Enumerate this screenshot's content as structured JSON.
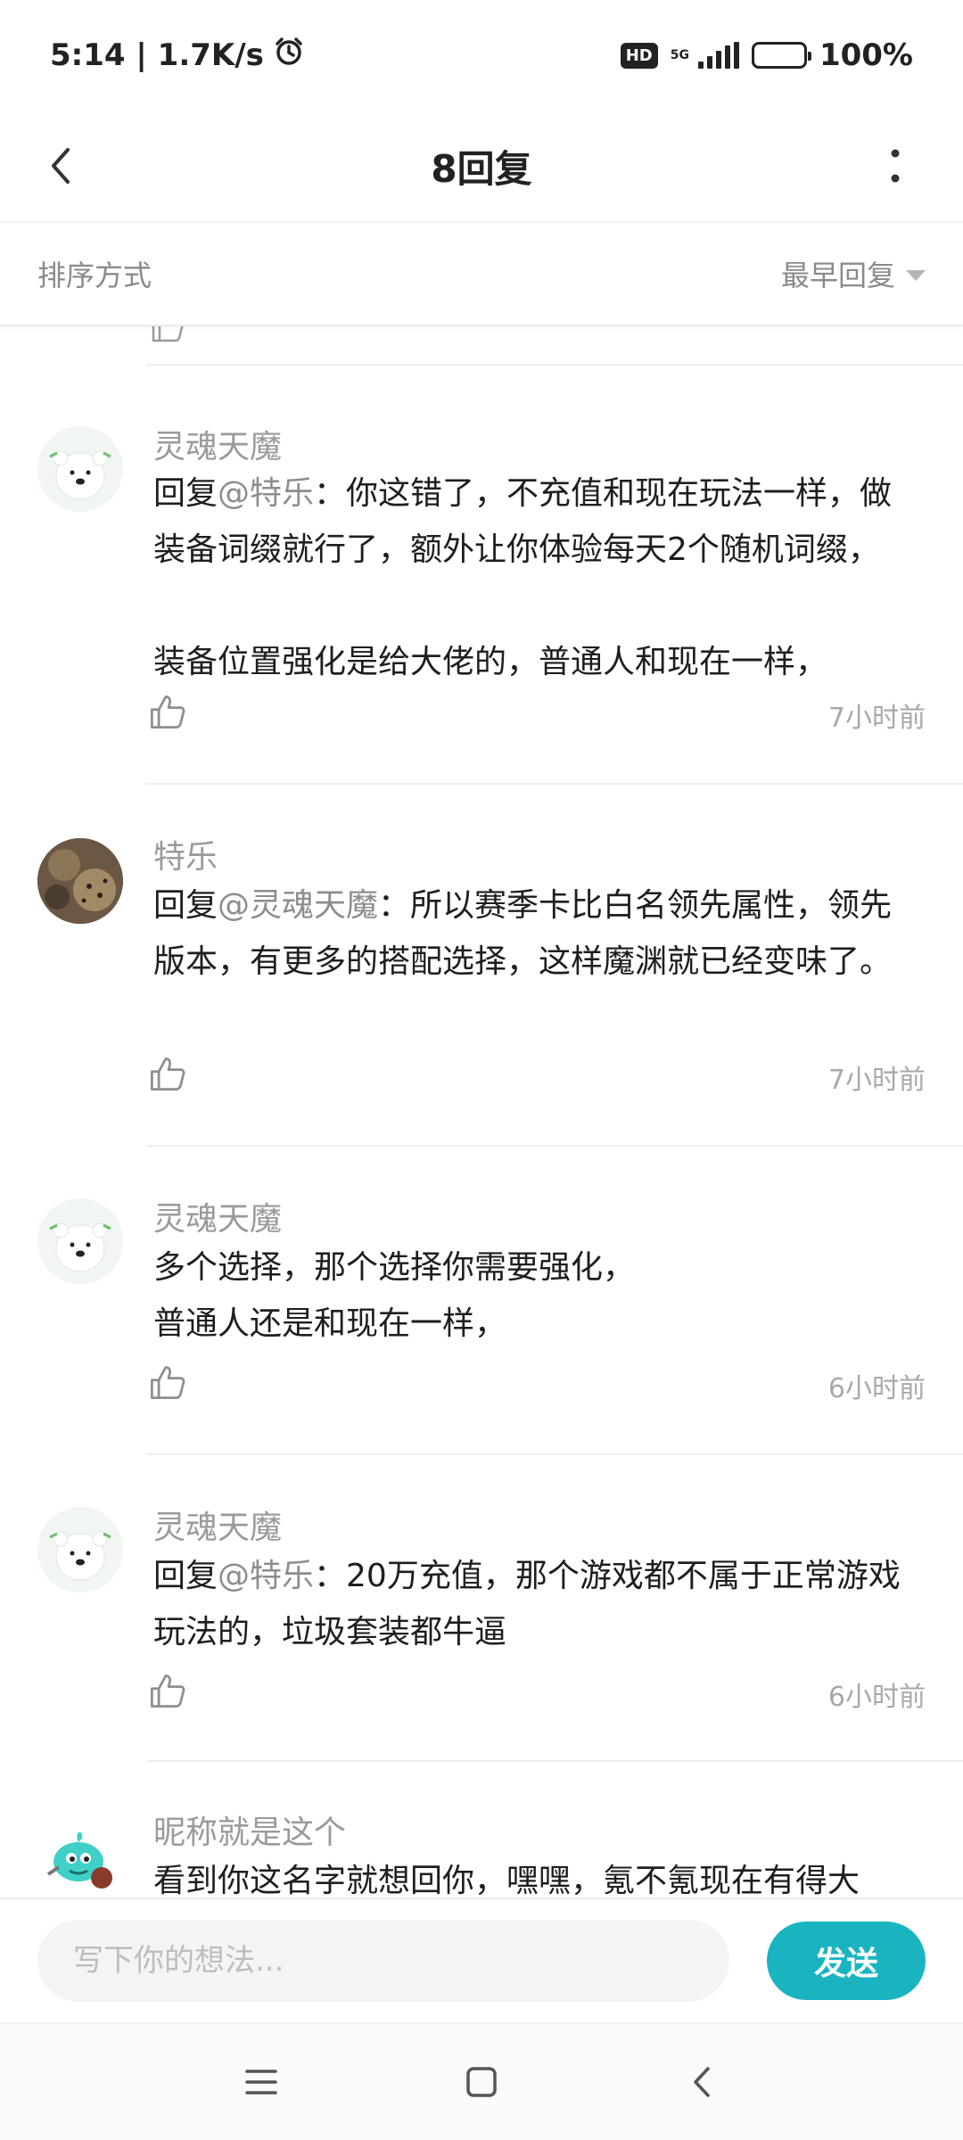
{
  "status_bar": {
    "time_speed": "5:14 | 1.7K/s",
    "hd_badge": "HD",
    "network": "5G",
    "battery": "100%",
    "battery_level": 1.0,
    "icons": [
      "alarm-icon",
      "signal-icon",
      "battery-icon"
    ]
  },
  "header": {
    "title": "8回复",
    "back_icon": "chevron-left-icon",
    "more_icon": "more-vertical-icon"
  },
  "sort": {
    "label": "排序方式",
    "selected": "最早回复"
  },
  "replies": [
    {
      "username": "灵魂天魔",
      "avatar_icon": "polar-bear-avatar",
      "prefix": "回复",
      "mention": "@特乐",
      "text": "：你这错了，不充值和现在玩法一样，做装备词缀就行了，额外让你体验每天2个随机词缀，\n\n装备位置强化是给大佬的，普通人和现在一样，",
      "time": "7小时前"
    },
    {
      "username": "特乐",
      "avatar_icon": "leopard-photo-avatar",
      "prefix": "回复",
      "mention": "@灵魂天魔",
      "text": "：所以赛季卡比白名领先属性，领先版本，有更多的搭配选择，这样魔渊就已经变味了。",
      "time": "7小时前"
    },
    {
      "username": "灵魂天魔",
      "avatar_icon": "polar-bear-avatar",
      "prefix": "",
      "mention": "",
      "text": "多个选择，那个选择你需要强化，\n普通人还是和现在一样，",
      "time": "6小时前"
    },
    {
      "username": "灵魂天魔",
      "avatar_icon": "polar-bear-avatar",
      "prefix": "回复",
      "mention": "@特乐",
      "text": "：20万充值，那个游戏都不属于正常游戏玩法的，垃圾套装都牛逼",
      "time": "6小时前"
    },
    {
      "username": "昵称就是这个",
      "avatar_icon": "cartoon-fish-avatar",
      "prefix": "",
      "mention": "",
      "text": "看到你这名字就想回你，嘿嘿，氪不氪现在有得大",
      "time": ""
    }
  ],
  "composer": {
    "placeholder": "写下你的想法...",
    "send_label": "发送"
  },
  "colors": {
    "accent": "#1ab4c0",
    "muted_text": "#9a9a9a",
    "divider": "#efefef"
  },
  "nav_bar": {
    "icons": [
      "menu-icon",
      "home-square-icon",
      "back-triangle-icon"
    ]
  }
}
